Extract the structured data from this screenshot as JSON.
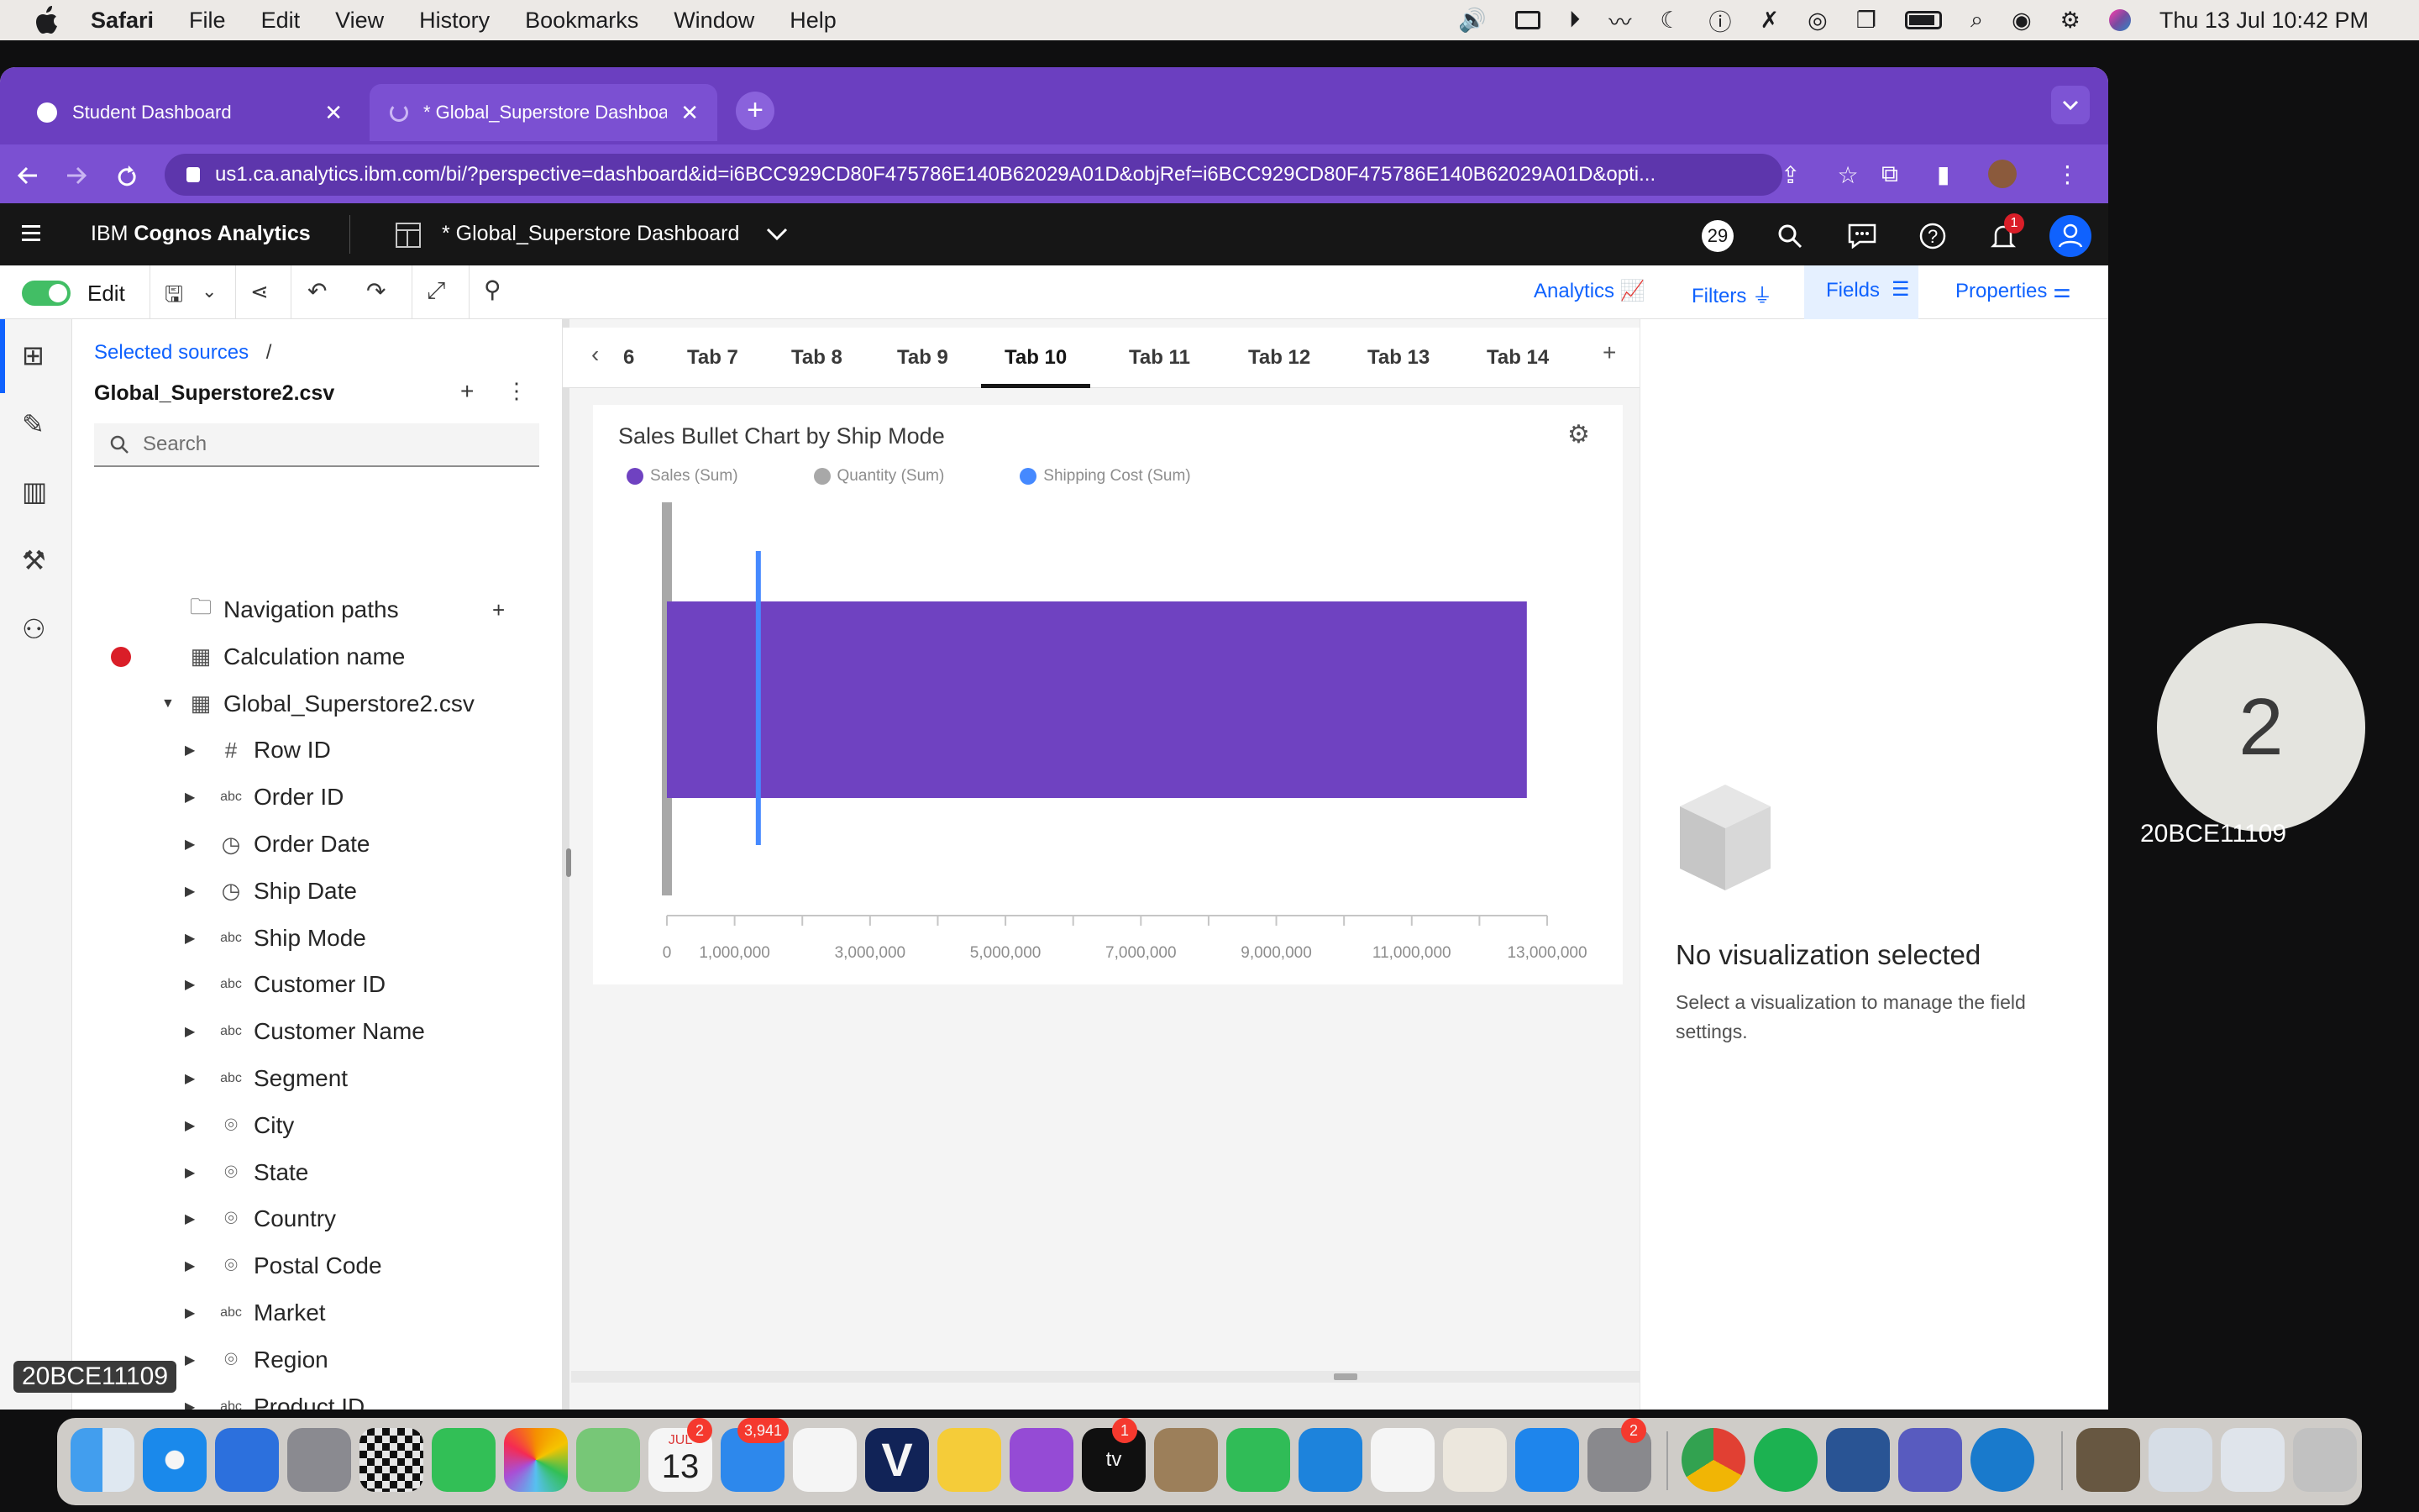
{
  "menubar": {
    "app": "Safari",
    "items": [
      "File",
      "Edit",
      "View",
      "History",
      "Bookmarks",
      "Window",
      "Help"
    ],
    "clock": "Thu 13 Jul  10:42 PM"
  },
  "browser": {
    "tabs": [
      {
        "label": "Student Dashboard"
      },
      {
        "label": "* Global_Superstore Dashboa"
      }
    ],
    "url": "us1.ca.analytics.ibm.com/bi/?perspective=dashboard&id=i6BCC929CD80F475786E140B62029A01D&objRef=i6BCC929CD80F475786E140B62029A01D&opti..."
  },
  "cognos": {
    "brand_prefix": "IBM ",
    "brand": "Cognos Analytics",
    "doc_title": "* Global_Superstore Dashboard",
    "badge_count": "29",
    "notif_count": "1"
  },
  "toolbar": {
    "edit_label": "Edit",
    "analytics": "Analytics",
    "filters": "Filters",
    "fields": "Fields",
    "properties": "Properties"
  },
  "source": {
    "breadcrumb": "Selected sources",
    "breadcrumb_sep": "/",
    "dataset": "Global_Superstore2.csv",
    "search_placeholder": "Search",
    "items": [
      {
        "label": "Navigation paths",
        "icon": "folder-icon"
      },
      {
        "label": "Calculation name",
        "icon": "table-calc-icon"
      },
      {
        "label": "Global_Superstore2.csv",
        "icon": "table-icon"
      },
      {
        "label": "Row ID",
        "icon": "#"
      },
      {
        "label": "Order ID",
        "icon": "abc"
      },
      {
        "label": "Order Date",
        "icon": "clock-icon"
      },
      {
        "label": "Ship Date",
        "icon": "clock-icon"
      },
      {
        "label": "Ship Mode",
        "icon": "abc"
      },
      {
        "label": "Customer ID",
        "icon": "abc"
      },
      {
        "label": "Customer Name",
        "icon": "abc"
      },
      {
        "label": "Segment",
        "icon": "abc"
      },
      {
        "label": "City",
        "icon": "location-icon"
      },
      {
        "label": "State",
        "icon": "location-icon"
      },
      {
        "label": "Country",
        "icon": "location-icon"
      },
      {
        "label": "Postal Code",
        "icon": "location-icon"
      },
      {
        "label": "Market",
        "icon": "abc"
      },
      {
        "label": "Region",
        "icon": "location-icon"
      },
      {
        "label": "Product ID",
        "icon": "abc"
      }
    ]
  },
  "dashboard_tabs": [
    "6",
    "Tab 7",
    "Tab 8",
    "Tab 9",
    "Tab 10",
    "Tab 11",
    "Tab 12",
    "Tab 13",
    "Tab 14"
  ],
  "active_tab": "Tab 10",
  "chart_data": {
    "type": "bar",
    "title": "Sales Bullet Chart by Ship Mode",
    "series": [
      {
        "name": "Sales (Sum)",
        "values": [
          12700000
        ],
        "color": "#6f42c1"
      },
      {
        "name": "Quantity (Sum)",
        "values": [
          0
        ],
        "color": "#a8a8a8"
      },
      {
        "name": "Shipping Cost (Sum)",
        "values": [
          1350000
        ],
        "color": "#4589ff"
      }
    ],
    "x_ticks": [
      "0",
      "1,000,000",
      "3,000,000",
      "5,000,000",
      "7,000,000",
      "9,000,000",
      "11,000,000",
      "13,000,000"
    ],
    "tick_values": [
      0,
      1000000,
      3000000,
      5000000,
      7000000,
      9000000,
      11000000,
      13000000
    ],
    "xlim": [
      0,
      13000000
    ],
    "xlabel": "",
    "ylabel": ""
  },
  "rpanel": {
    "title": "No visualization selected",
    "desc": "Select a visualization to manage the field settings."
  },
  "meeting": {
    "avatar_number": "2",
    "participant": "20BCE11109",
    "corner_label": "20BCE11109"
  },
  "dock": {
    "calendar_month": "JUL",
    "calendar_day": "13",
    "mail_badge": "3,941",
    "calendar_badge": "2",
    "tv_badge": "1",
    "settings_badge": "2"
  }
}
